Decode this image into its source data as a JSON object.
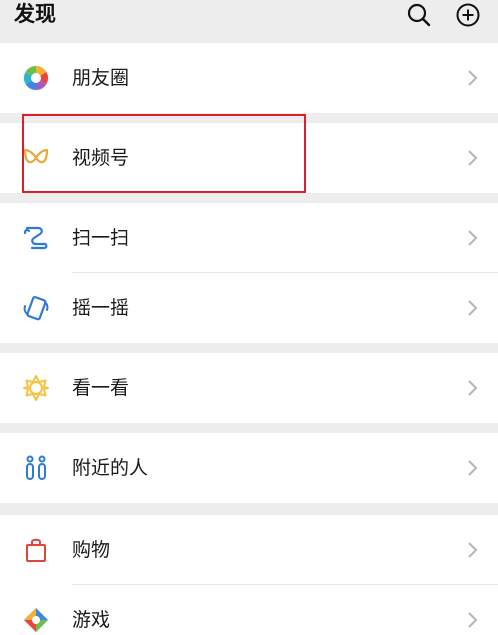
{
  "header": {
    "title": "发现",
    "search_icon": "search-icon",
    "add_icon": "plus-circle-icon"
  },
  "items": {
    "moments": {
      "label": "朋友圈",
      "icon": "moments-aperture-icon"
    },
    "channels": {
      "label": "视频号",
      "icon": "channels-butterfly-icon"
    },
    "scan": {
      "label": "扫一扫",
      "icon": "scan-icon"
    },
    "shake": {
      "label": "摇一摇",
      "icon": "shake-phone-icon"
    },
    "top_stories": {
      "label": "看一看",
      "icon": "top-stories-icon"
    },
    "people_nearby": {
      "label": "附近的人",
      "icon": "people-nearby-icon"
    },
    "shopping": {
      "label": "购物",
      "icon": "shopping-bag-icon"
    },
    "games": {
      "label": "游戏",
      "icon": "games-diamond-icon"
    }
  },
  "colors": {
    "background": "#ededed",
    "surface": "#ffffff",
    "highlight_border": "#d9202b",
    "channels_icon": "#e8a93a",
    "scan_icon": "#2f7bd3",
    "top_stories_icon": "#f5c342",
    "people_icon": "#2f7bd3",
    "shopping_icon": "#e0453a"
  }
}
